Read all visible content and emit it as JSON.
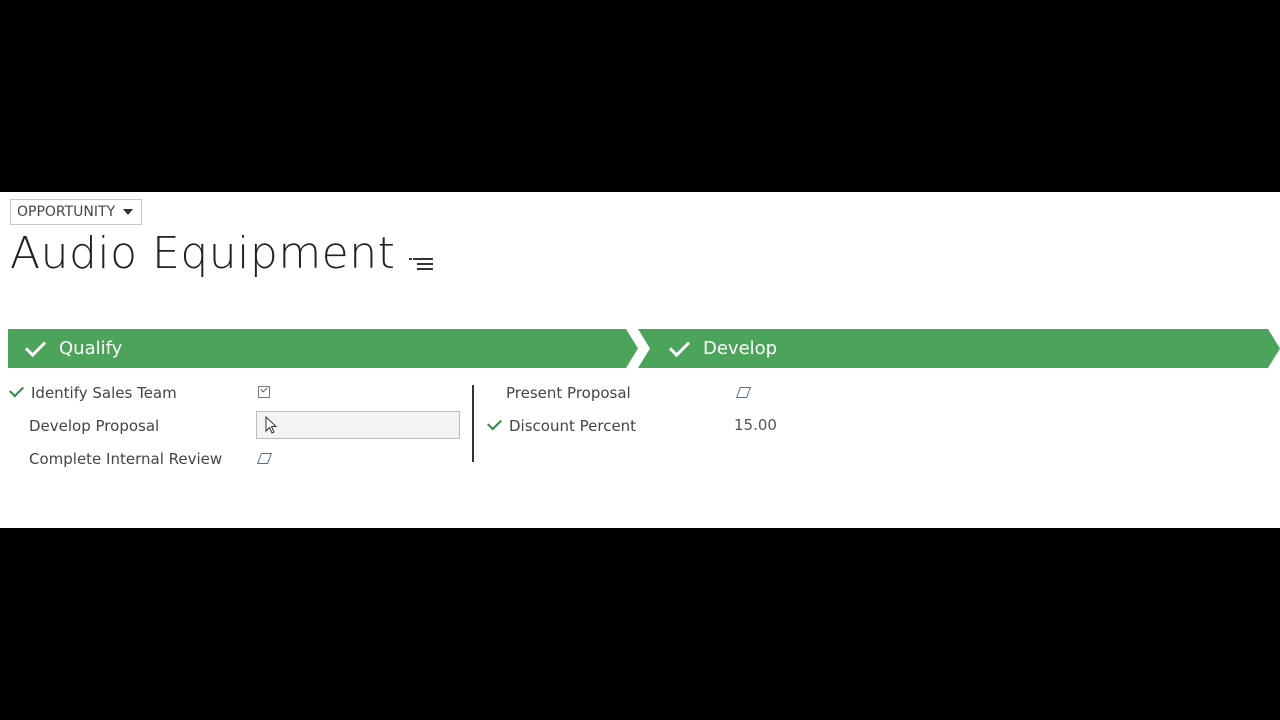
{
  "header": {
    "entity_label": "OPPORTUNITY",
    "record_title": "Audio Equipment"
  },
  "stages": [
    {
      "label": "Qualify",
      "completed": true
    },
    {
      "label": "Develop",
      "completed": true
    }
  ],
  "qualify_steps": [
    {
      "label": "Identify Sales Team",
      "completed": true,
      "field": "checkbox-checked"
    },
    {
      "label": "Develop Proposal",
      "completed": false,
      "field": "text-input"
    },
    {
      "label": "Complete Internal Review",
      "completed": false,
      "field": "edit-icon"
    }
  ],
  "develop_steps": [
    {
      "label": "Present Proposal",
      "completed": false,
      "field": "edit-icon"
    },
    {
      "label": "Discount Percent",
      "completed": true,
      "value": "15.00"
    }
  ],
  "colors": {
    "stage_green": "#4ca35a",
    "check_green": "#2e8b3a",
    "edit_icon_blue": "#3b6fb6"
  }
}
